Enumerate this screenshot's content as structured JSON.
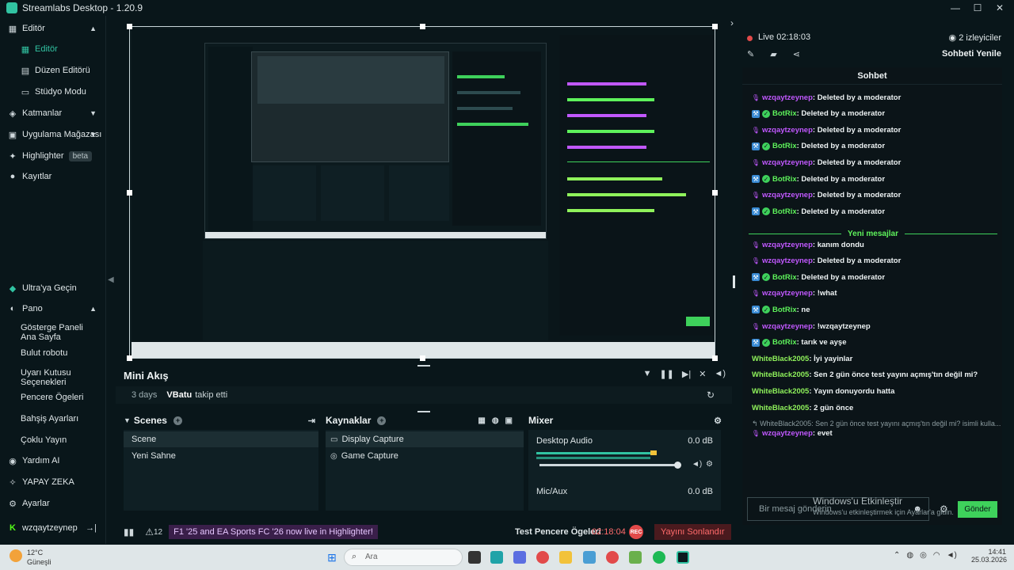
{
  "window": {
    "title": "Streamlabs Desktop - 1.20.9"
  },
  "sidebar": {
    "editor_group": "Editör",
    "items": [
      {
        "label": "Editör"
      },
      {
        "label": "Düzen Editörü"
      },
      {
        "label": "Stüdyo Modu"
      }
    ],
    "layers": "Katmanlar",
    "app_store": "Uygulama Mağazası",
    "highlighter": "Highlighter",
    "highlighter_badge": "beta",
    "recordings": "Kayıtlar",
    "ultra": "Ultra'ya Geçin",
    "pano": "Pano",
    "pano_items": [
      "Gösterge Paneli Ana Sayfa",
      "Bulut robotu",
      "Uyarı Kutusu Seçenekleri",
      "Pencere Ögeleri",
      "Bahşiş Ayarları",
      "Çoklu Yayın"
    ],
    "help_ai": "Yardım AI",
    "yapay_zeka": "YAPAY ZEKA",
    "settings": "Ayarlar",
    "user": "wzqaytzeynep"
  },
  "minifeed": {
    "title": "Mini Akış",
    "time": "3 days",
    "user": "VBatu",
    "action": "takip etti"
  },
  "scenes": {
    "title": "Scenes",
    "items": [
      "Scene",
      "Yeni Sahne"
    ]
  },
  "sources": {
    "title": "Kaynaklar",
    "items": [
      "Display Capture",
      "Game Capture"
    ]
  },
  "mixer": {
    "title": "Mixer",
    "channels": [
      {
        "name": "Desktop Audio",
        "db": "0.0 dB"
      },
      {
        "name": "Mic/Aux",
        "db": "0.0 dB"
      }
    ]
  },
  "footer": {
    "count": "12",
    "notice": "F1 '25 and EA Sports FC '26 now live in Highlighter!",
    "test_items": "Test Pencere Ögeleri",
    "timer": "02:18:04",
    "rec": "REC",
    "end_stream": "Yayını Sonlandır"
  },
  "chat": {
    "live_label": "Live",
    "live_time": "02:18:03",
    "viewers": "2 izleyiciler",
    "refresh": "Sohbeti Yenile",
    "title": "Sohbet",
    "new_messages": "Yeni mesajlar",
    "messages": [
      {
        "user": "wzqaytzeynep",
        "text": ": Deleted by a moderator",
        "type": "mod"
      },
      {
        "user": "BotRix",
        "text": ": Deleted by a moderator",
        "type": "bot"
      },
      {
        "user": "wzqaytzeynep",
        "text": ": Deleted by a moderator",
        "type": "mod"
      },
      {
        "user": "BotRix",
        "text": ": Deleted by a moderator",
        "type": "bot"
      },
      {
        "user": "wzqaytzeynep",
        "text": ": Deleted by a moderator",
        "type": "mod"
      },
      {
        "user": "BotRix",
        "text": ": Deleted by a moderator",
        "type": "bot"
      },
      {
        "user": "wzqaytzeynep",
        "text": ": Deleted by a moderator",
        "type": "mod"
      },
      {
        "user": "BotRix",
        "text": ": Deleted by a moderator",
        "type": "bot"
      }
    ],
    "messages_new": [
      {
        "user": "wzqaytzeynep",
        "text": ": kanım dondu",
        "type": "mod"
      },
      {
        "user": "wzqaytzeynep",
        "text": ": Deleted by a moderator",
        "type": "mod"
      },
      {
        "user": "BotRix",
        "text": ": Deleted by a moderator",
        "type": "bot"
      },
      {
        "user": "wzqaytzeynep",
        "text": ": !what",
        "type": "mod"
      },
      {
        "user": "BotRix",
        "text": ": ne",
        "type": "bot"
      },
      {
        "user": "wzqaytzeynep",
        "text": ": !wzqaytzeynep",
        "type": "mod"
      },
      {
        "user": "BotRix",
        "text": ": tarık ve ayşe",
        "type": "bot"
      },
      {
        "user": "WhiteBlack2005",
        "text": ": İyi yayinlar",
        "type": "plain"
      },
      {
        "user": "WhiteBlack2005",
        "text": ": Sen 2 gün önce test yayını açmış'tın değil mi?",
        "type": "plain"
      },
      {
        "user": "WhiteBlack2005",
        "text": ": Yayın donuyordu hatta",
        "type": "plain"
      },
      {
        "user": "WhiteBlack2005",
        "text": ": 2 gün önce",
        "type": "plain"
      }
    ],
    "reply_quote": "WhiteBlack2005: Sen 2 gün önce test yayını açmış'tın değil mi? isimli kulla...",
    "last": {
      "user": "wzqaytzeynep",
      "text": ": evet"
    },
    "input_placeholder": "Bir mesaj gönderin",
    "send": "Gönder",
    "watermark_title": "Windows'u Etkinleştir",
    "watermark_sub": "Windows'u etkinleştirmek için Ayarlar'a gidin."
  },
  "taskbar": {
    "temp": "12°C",
    "condition": "Güneşli",
    "search_placeholder": "Ara",
    "time": "14:41",
    "date": "25.03.2026"
  },
  "colors": {
    "accent": "#31c3a2",
    "chat_green": "#3ed15b",
    "mod_purple": "#c158ff",
    "live_red": "#e24a4a"
  }
}
